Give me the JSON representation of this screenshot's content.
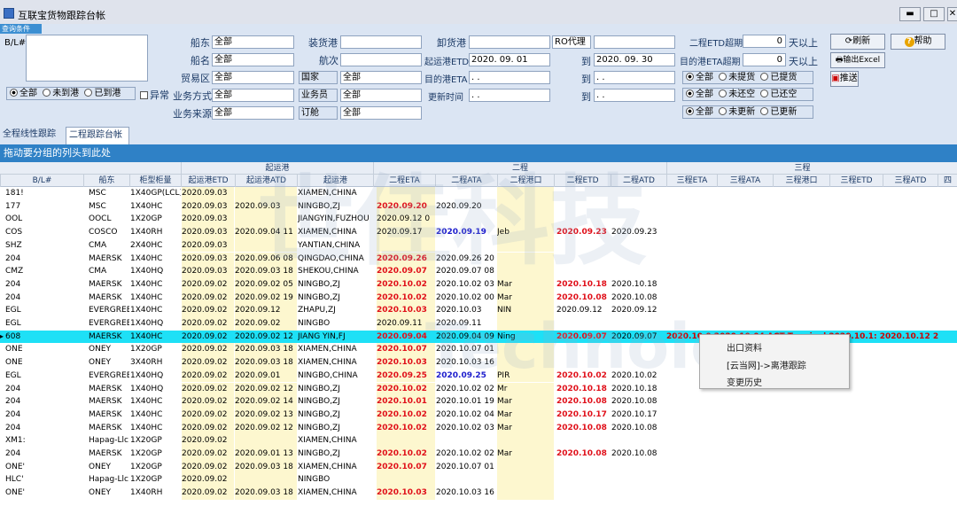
{
  "window": {
    "title": "互联宝货物跟踪台帐"
  },
  "query": {
    "tag": "查询条件",
    "bl_label": "B/L#",
    "fields": {
      "shipper": {
        "label": "船东",
        "value": "全部"
      },
      "vessel": {
        "label": "船名",
        "value": "全部"
      },
      "trade_zone": {
        "label": "贸易区",
        "value": "全部"
      },
      "biz_mode": {
        "label": "业务方式",
        "value": "全部"
      },
      "biz_source": {
        "label": "业务来源",
        "value": "全部"
      },
      "pol": {
        "label": "装货港",
        "value": ""
      },
      "voyage": {
        "label": "航次",
        "value": ""
      },
      "country": {
        "label": "国家",
        "value": "全部"
      },
      "salesman": {
        "label": "业务员",
        "value": "全部"
      },
      "booking": {
        "label": "订舱",
        "value": "全部"
      },
      "pod": {
        "label": "卸货港",
        "value": ""
      },
      "ro_agent": {
        "label": "",
        "value": "RO代理"
      },
      "ro_agent_value": "",
      "etd": {
        "label": "起运港ETD",
        "from": "2020. 09. 01",
        "to_label": "到",
        "to": "2020. 09. 30"
      },
      "eta": {
        "label": "目的港ETA",
        "from": "  .  .",
        "to_label": "到",
        "to": "  .  ."
      },
      "update": {
        "label": "更新时间",
        "from": "  .  .",
        "to_label": "到",
        "to": "  .  ."
      },
      "etd_over": {
        "label": "二程ETD超期",
        "value": "0",
        "unit": "天以上"
      },
      "eta_over": {
        "label": "目的港ETA超期",
        "value": "0",
        "unit": "天以上"
      }
    },
    "radio_arrival": [
      "全部",
      "未到港",
      "已到港"
    ],
    "abnormal_label": "异常",
    "radio_pickup": [
      "全部",
      "未提货",
      "已提货"
    ],
    "radio_return": [
      "全部",
      "未还空",
      "已还空"
    ],
    "radio_updated": [
      "全部",
      "未更新",
      "已更新"
    ],
    "buttons": {
      "refresh": "刷新",
      "help": "帮助",
      "export": "输出Excel",
      "push": "推送"
    }
  },
  "tabs": [
    "全程线性跟踪",
    "二程跟踪台帐"
  ],
  "group_hint": "拖动要分组的列头到此处",
  "grid": {
    "group_headers": [
      "起运港",
      "二程",
      "三程"
    ],
    "columns": [
      "B/L#",
      "船东",
      "柜型柜量",
      "起运港ETD",
      "起运港ATD",
      "起运港",
      "二程ETA",
      "二程ATA",
      "二程港口",
      "二程ETD",
      "二程ATD",
      "三程ETA",
      "三程ATA",
      "三程港口",
      "三程ETD",
      "三程ATD",
      "四"
    ],
    "rows": [
      {
        "bl": "181!",
        "owner": "MSC",
        "ctype": "1X40GP(LCL)",
        "etd": "2020.09.03",
        "atd": "",
        "pol": "XIAMEN,CHINA",
        "eta2": "",
        "ata2": "",
        "port2": "",
        "etd2": "",
        "atd2": "",
        "ex": ""
      },
      {
        "bl": "177",
        "owner": "MSC",
        "ctype": "1X40HC",
        "etd": "2020.09.03",
        "atd": "2020.09.03",
        "pol": "NINGBO,ZJ",
        "eta2": "2020.09.20",
        "ata2": "2020.09.20",
        "port2": "",
        "etd2": "",
        "atd2": "",
        "ex": ""
      },
      {
        "bl": "OOL",
        "owner": "OOCL",
        "ctype": "1X20GP",
        "etd": "2020.09.03",
        "atd": "",
        "pol": "JIANGYIN,FUZHOU",
        "eta2": "2020.09.12 0",
        "ata2": "",
        "port2": "",
        "etd2": "",
        "atd2": "",
        "ex": ""
      },
      {
        "bl": "COS",
        "owner": "COSCO",
        "ctype": "1X40RH",
        "etd": "2020.09.03",
        "atd": "2020.09.04 11",
        "pol": "XIAMEN,CHINA",
        "eta2": "2020.09.17",
        "ata2": "2020.09.19",
        "port2": "Jeb",
        "etd2": "2020.09.23",
        "atd2": "2020.09.23",
        "ex": ""
      },
      {
        "bl": "SHZ",
        "owner": "CMA",
        "ctype": "2X40HC",
        "etd": "2020.09.03",
        "atd": "",
        "pol": "YANTIAN,CHINA",
        "eta2": "",
        "ata2": "",
        "port2": "",
        "etd2": "",
        "atd2": "",
        "ex": ""
      },
      {
        "bl": "204",
        "owner": "MAERSK",
        "ctype": "1X40HC",
        "etd": "2020.09.03",
        "atd": "2020.09.06 08",
        "pol": "QINGDAO,CHINA",
        "eta2": "2020.09.26",
        "ata2": "2020.09.26 20",
        "port2": "",
        "etd2": "",
        "atd2": "",
        "ex": ""
      },
      {
        "bl": "CMZ",
        "owner": "CMA",
        "ctype": "1X40HQ",
        "etd": "2020.09.03",
        "atd": "2020.09.03 18",
        "pol": "SHEKOU,CHINA",
        "eta2": "2020.09.07",
        "ata2": "2020.09.07 08",
        "port2": "",
        "etd2": "",
        "atd2": "",
        "ex": ""
      },
      {
        "bl": "204",
        "owner": "MAERSK",
        "ctype": "1X40HC",
        "etd": "2020.09.02",
        "atd": "2020.09.02 05",
        "pol": "NINGBO,ZJ",
        "eta2": "2020.10.02",
        "ata2": "2020.10.02 03",
        "port2": "Mar",
        "etd2": "2020.10.18",
        "atd2": "2020.10.18",
        "ex": ""
      },
      {
        "bl": "204",
        "owner": "MAERSK",
        "ctype": "1X40HC",
        "etd": "2020.09.02",
        "atd": "2020.09.02 19",
        "pol": "NINGBO,ZJ",
        "eta2": "2020.10.02",
        "ata2": "2020.10.02 00",
        "port2": "Mar",
        "etd2": "2020.10.08",
        "atd2": "2020.10.08",
        "ex": ""
      },
      {
        "bl": "EGL",
        "owner": "EVERGREEN",
        "ctype": "1X40HC",
        "etd": "2020.09.02",
        "atd": "2020.09.12",
        "pol": "ZHAPU,ZJ",
        "eta2": "2020.10.03",
        "ata2": "2020.10.03",
        "port2": "NIN",
        "etd2": "2020.09.12",
        "atd2": "2020.09.12",
        "ex": ""
      },
      {
        "bl": "EGL",
        "owner": "EVERGREEN",
        "ctype": "1X40HQ",
        "etd": "2020.09.02",
        "atd": "2020.09.02",
        "pol": "NINGBO",
        "eta2": "2020.09.11",
        "ata2": "2020.09.11",
        "port2": "",
        "etd2": "",
        "atd2": "",
        "ex": ""
      },
      {
        "bl": "608",
        "owner": "MAERSK",
        "ctype": "1X40HC",
        "etd": "2020.09.02",
        "atd": "2020.09.02 12",
        "pol": "JIANG YIN,FJ",
        "eta2": "2020.09.04",
        "ata2": "2020.09.04 09",
        "port2": "Ning",
        "etd2": "2020.09.07",
        "atd2": "2020.09.07",
        "ex": "2020.10.0   2020.10.04 ACT Terminal  2020.10.1: 2020.10.12 2"
      },
      {
        "bl": "ONE",
        "owner": "ONEY",
        "ctype": "1X20GP",
        "etd": "2020.09.02",
        "atd": "2020.09.03 18",
        "pol": "XIAMEN,CHINA",
        "eta2": "2020.10.07",
        "ata2": "2020.10.07 01",
        "port2": "",
        "etd2": "",
        "atd2": "",
        "ex": ""
      },
      {
        "bl": "ONE",
        "owner": "ONEY",
        "ctype": "3X40RH",
        "etd": "2020.09.02",
        "atd": "2020.09.03 18",
        "pol": "XIAMEN,CHINA",
        "eta2": "2020.10.03",
        "ata2": "2020.10.03 16",
        "port2": "",
        "etd2": "",
        "atd2": "",
        "ex": ""
      },
      {
        "bl": "EGL",
        "owner": "EVERGREEN",
        "ctype": "1X40HQ",
        "etd": "2020.09.02",
        "atd": "2020.09.01",
        "pol": "NINGBO,CHINA",
        "eta2": "2020.09.25",
        "ata2": "2020.09.25",
        "port2": "PIR",
        "etd2": "2020.10.02",
        "atd2": "2020.10.02",
        "ex": ""
      },
      {
        "bl": "204",
        "owner": "MAERSK",
        "ctype": "1X40HQ",
        "etd": "2020.09.02",
        "atd": "2020.09.02 12",
        "pol": "NINGBO,ZJ",
        "eta2": "2020.10.02",
        "ata2": "2020.10.02 02",
        "port2": "Mr",
        "etd2": "2020.10.18",
        "atd2": "2020.10.18",
        "ex": ""
      },
      {
        "bl": "204",
        "owner": "MAERSK",
        "ctype": "1X40HC",
        "etd": "2020.09.02",
        "atd": "2020.09.02 14",
        "pol": "NINGBO,ZJ",
        "eta2": "2020.10.01",
        "ata2": "2020.10.01 19",
        "port2": "Mar",
        "etd2": "2020.10.08",
        "atd2": "2020.10.08",
        "ex": ""
      },
      {
        "bl": "204",
        "owner": "MAERSK",
        "ctype": "1X40HC",
        "etd": "2020.09.02",
        "atd": "2020.09.02 13",
        "pol": "NINGBO,ZJ",
        "eta2": "2020.10.02",
        "ata2": "2020.10.02 04",
        "port2": "Mar",
        "etd2": "2020.10.17",
        "atd2": "2020.10.17",
        "ex": ""
      },
      {
        "bl": "204",
        "owner": "MAERSK",
        "ctype": "1X40HC",
        "etd": "2020.09.02",
        "atd": "2020.09.02 12",
        "pol": "NINGBO,ZJ",
        "eta2": "2020.10.02",
        "ata2": "2020.10.02 03",
        "port2": "Mar",
        "etd2": "2020.10.08",
        "atd2": "2020.10.08",
        "ex": ""
      },
      {
        "bl": "XM1:",
        "owner": "Hapag-Llc",
        "ctype": "1X20GP",
        "etd": "2020.09.02",
        "atd": "",
        "pol": "XIAMEN,CHINA",
        "eta2": "",
        "ata2": "",
        "port2": "",
        "etd2": "",
        "atd2": "",
        "ex": ""
      },
      {
        "bl": "204",
        "owner": "MAERSK",
        "ctype": "1X20GP",
        "etd": "2020.09.02",
        "atd": "2020.09.01 13",
        "pol": "NINGBO,ZJ",
        "eta2": "2020.10.02",
        "ata2": "2020.10.02 02",
        "port2": "Mar",
        "etd2": "2020.10.08",
        "atd2": "2020.10.08",
        "ex": ""
      },
      {
        "bl": "ONE'",
        "owner": "ONEY",
        "ctype": "1X20GP",
        "etd": "2020.09.02",
        "atd": "2020.09.03 18",
        "pol": "XIAMEN,CHINA",
        "eta2": "2020.10.07",
        "ata2": "2020.10.07 01",
        "port2": "",
        "etd2": "",
        "atd2": "",
        "ex": ""
      },
      {
        "bl": "HLC'",
        "owner": "Hapag-Llc",
        "ctype": "1X20GP",
        "etd": "2020.09.02",
        "atd": "",
        "pol": "NINGBO",
        "eta2": "",
        "ata2": "",
        "port2": "",
        "etd2": "",
        "atd2": "",
        "ex": ""
      },
      {
        "bl": "ONE'",
        "owner": "ONEY",
        "ctype": "1X40RH",
        "etd": "2020.09.02",
        "atd": "2020.09.03 18",
        "pol": "XIAMEN,CHINA",
        "eta2": "2020.10.03",
        "ata2": "2020.10.03 16",
        "port2": "",
        "etd2": "",
        "atd2": "",
        "ex": ""
      }
    ]
  },
  "context_menu": [
    "出口资料",
    "[云当网]->离港跟踪",
    "变更历史"
  ],
  "watermark": {
    "cn": "世佳科技",
    "en": "Technology"
  }
}
